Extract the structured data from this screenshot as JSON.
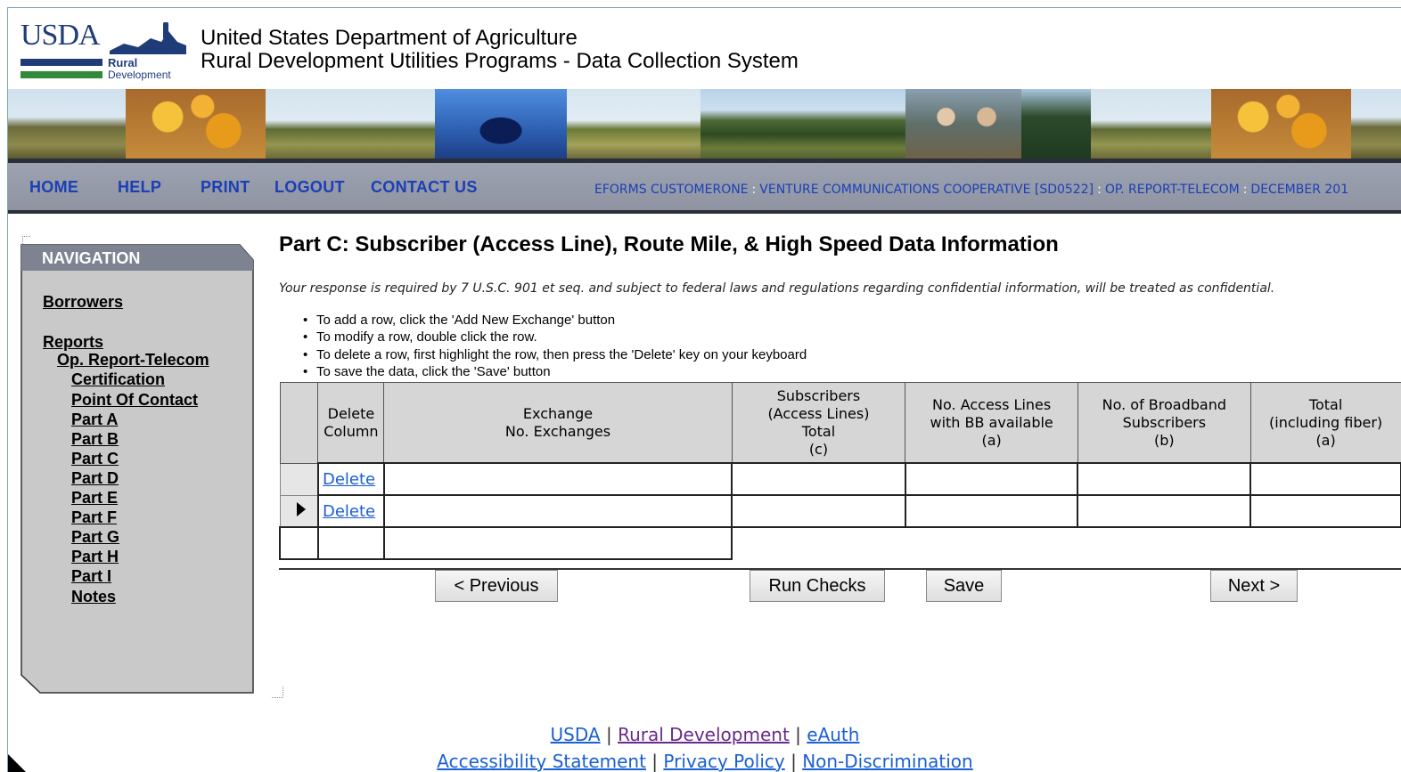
{
  "header": {
    "logo_text": "USDA",
    "logo_sub1": "Rural",
    "logo_sub2": "Development",
    "title_line1": "United States Department of Agriculture",
    "title_line2": "Rural Development Utilities Programs - Data Collection System"
  },
  "topnav": {
    "home": "HOME",
    "help": "HELP",
    "print": "PRINT",
    "logout": "LOGOUT",
    "contact": "CONTACT US",
    "breadcrumb": [
      "EFORMS CUSTOMERONE",
      "VENTURE COMMUNICATIONS COOPERATIVE [SD0522]",
      "OP. REPORT-TELECOM",
      "DECEMBER 201"
    ],
    "separator": ":"
  },
  "sidebar": {
    "heading": "NAVIGATION",
    "items": [
      {
        "label": "Borrowers"
      },
      {
        "label": "Reports"
      },
      {
        "label": "Op. Report-Telecom"
      },
      {
        "label": "Certification"
      },
      {
        "label": "Point Of Contact"
      },
      {
        "label": "Part A"
      },
      {
        "label": "Part B"
      },
      {
        "label": "Part C"
      },
      {
        "label": "Part D"
      },
      {
        "label": "Part E"
      },
      {
        "label": "Part F"
      },
      {
        "label": "Part G"
      },
      {
        "label": "Part H"
      },
      {
        "label": "Part I"
      },
      {
        "label": "Notes"
      }
    ]
  },
  "main": {
    "title": "Part C: Subscriber (Access Line), Route Mile, & High Speed Data Information",
    "notice": "Your response is required by 7 U.S.C. 901 et seq. and subject to federal laws and regulations regarding confidential information, will be treated as confidential.",
    "instructions": [
      "To add a row, click the 'Add New Exchange' button",
      "To modify a row, double click the row.",
      "To delete a row, first highlight the row, then press the 'Delete' key on your keyboard",
      "To save the data, click the 'Save' button"
    ],
    "table": {
      "headers": [
        {
          "line1": "Delete",
          "line2": "Column"
        },
        {
          "line1": "Exchange",
          "line2": "No. Exchanges"
        },
        {
          "line1": "Subscribers",
          "line2": "(Access Lines)",
          "line3": "Total",
          "line4": "(c)"
        },
        {
          "line1": "No. Access Lines",
          "line2": "with BB available",
          "line3": "(a)"
        },
        {
          "line1": "No. of Broadband",
          "line2": "Subscribers",
          "line3": "(b)"
        },
        {
          "line1": "Total",
          "line2": "(including fiber)",
          "line3": "(a)"
        }
      ],
      "delete_label": "Delete"
    },
    "buttons": {
      "previous": "< Previous",
      "run_checks": "Run Checks",
      "save": "Save",
      "next": "Next >"
    }
  },
  "footer": {
    "usda": "USDA",
    "rural_dev": "Rural Development",
    "eauth": "eAuth",
    "accessibility": "Accessibility Statement",
    "privacy": "Privacy Policy",
    "nondiscrimination": "Non-Discrimination",
    "pipe": "|"
  },
  "colors": {
    "link_blue": "#1b3fb5",
    "nav_bar": "#9da2b0",
    "sidebar_bg": "#c8c8c8",
    "sidebar_header": "#7e8391"
  }
}
